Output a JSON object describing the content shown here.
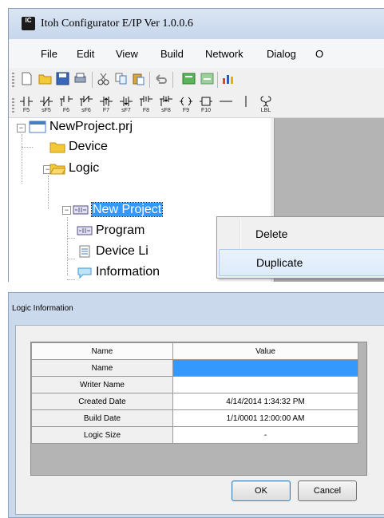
{
  "main_window": {
    "title": "Itoh Configurator E/IP Ver 1.0.0.6",
    "logo_text": "IC",
    "menu": [
      "File",
      "Edit",
      "View",
      "Build",
      "Network",
      "Dialog",
      "O"
    ],
    "ladder_toolbar_labels": [
      "F5",
      "sF5",
      "F6",
      "sF6",
      "F7",
      "sF7",
      "F8",
      "sF8",
      "F9",
      "F10",
      "",
      "",
      "LBL"
    ],
    "tree": {
      "project": "NewProject.prj",
      "device": "Device",
      "logic": "Logic",
      "new_project": "New Project",
      "program": "Program",
      "device_list": "Device Li",
      "information": "Information"
    },
    "context_menu": {
      "delete": "Delete",
      "duplicate": "Duplicate"
    },
    "colors": {
      "selection": "#3399ff",
      "workspace": "#b4b4b4"
    }
  },
  "dialog": {
    "title": "Logic Information",
    "columns": [
      "Name",
      "Value"
    ],
    "rows": [
      {
        "name": "Name",
        "value": ""
      },
      {
        "name": "Writer Name",
        "value": ""
      },
      {
        "name": "Created Date",
        "value": "4/14/2014 1:34:32 PM"
      },
      {
        "name": "Build Date",
        "value": "1/1/0001 12:00:00 AM"
      },
      {
        "name": "Logic Size",
        "value": "-"
      }
    ],
    "ok_label": "OK",
    "cancel_label": "Cancel"
  }
}
